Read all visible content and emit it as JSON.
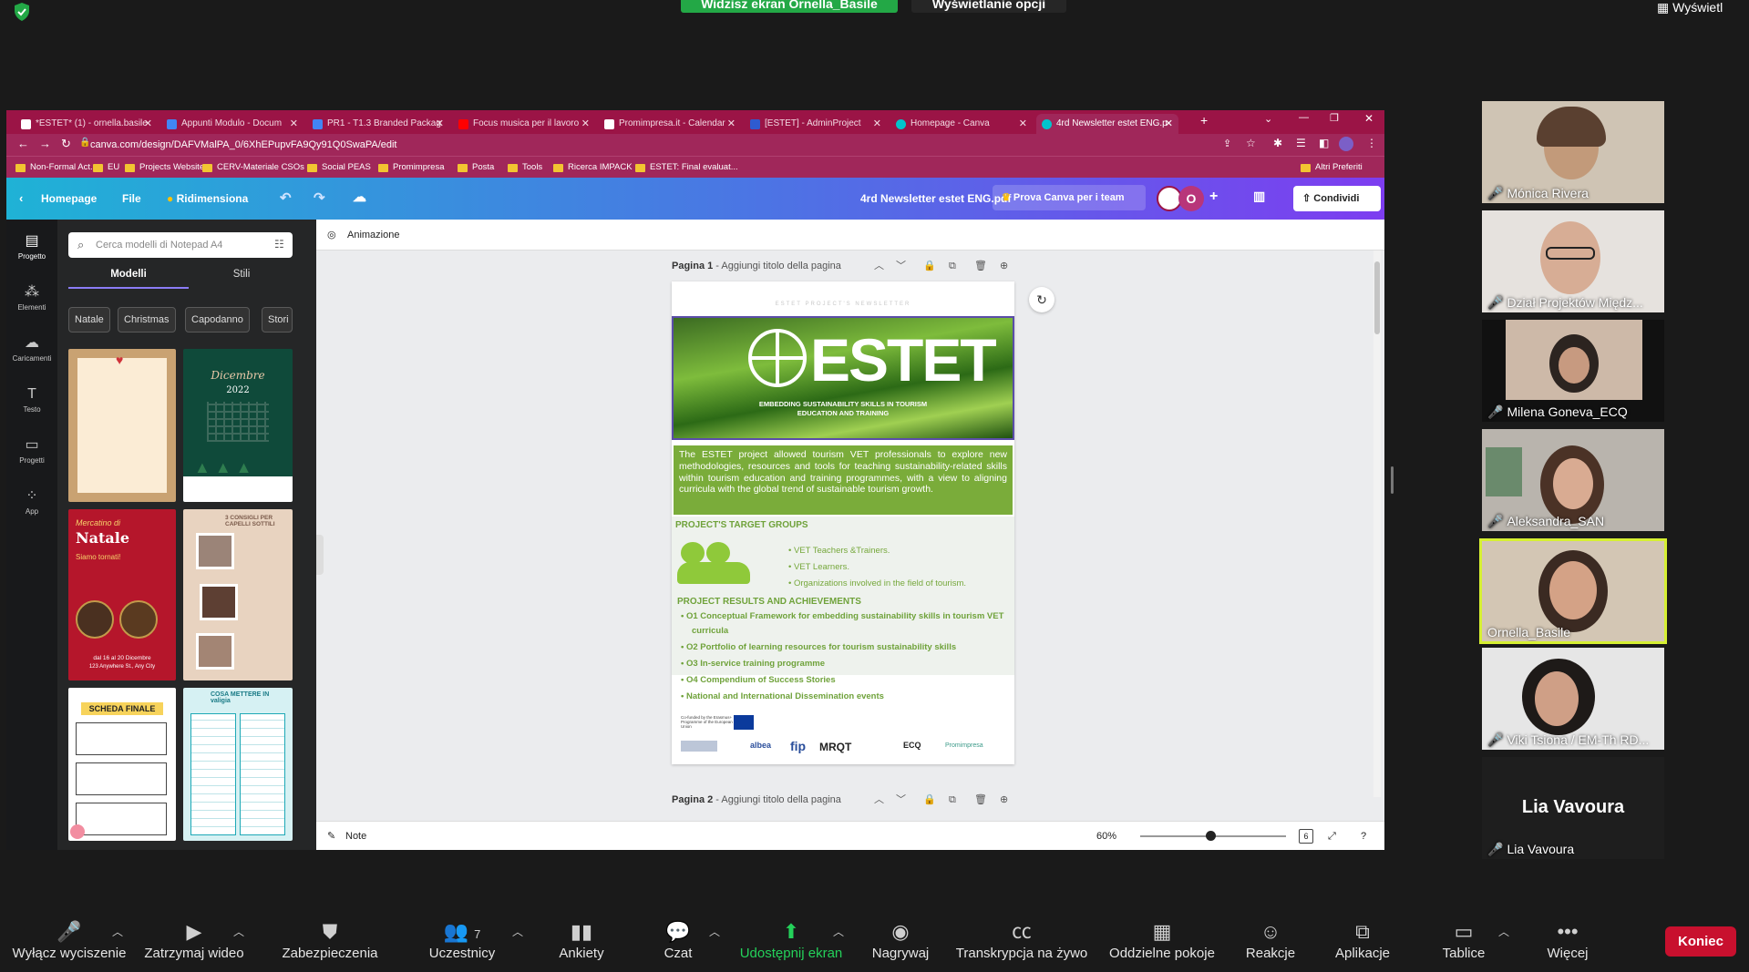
{
  "zoom": {
    "share_banner": "Widzisz ekran Ornella_Basile",
    "view_options": "Wyświetlanie opcji",
    "view_right": "Wyświetl",
    "end_button": "Koniec",
    "participant_count": "7",
    "toolbar": [
      {
        "label": "Wyłącz wyciszenie",
        "icon": "mic-muted-icon"
      },
      {
        "label": "Zatrzymaj wideo",
        "icon": "video-icon"
      },
      {
        "label": "Zabezpieczenia",
        "icon": "shield-icon"
      },
      {
        "label": "Uczestnicy",
        "icon": "people-icon"
      },
      {
        "label": "Ankiety",
        "icon": "bar-chart-icon"
      },
      {
        "label": "Czat",
        "icon": "chat-icon"
      },
      {
        "label": "Udostępnij ekran",
        "icon": "share-screen-icon"
      },
      {
        "label": "Nagrywaj",
        "icon": "record-icon"
      },
      {
        "label": "Transkrypcja na żywo",
        "icon": "cc-icon"
      },
      {
        "label": "Oddzielne pokoje",
        "icon": "rooms-icon"
      },
      {
        "label": "Reakcje",
        "icon": "emoji-icon"
      },
      {
        "label": "Aplikacje",
        "icon": "apps-icon"
      },
      {
        "label": "Tablice",
        "icon": "whiteboard-icon"
      },
      {
        "label": "Więcej",
        "icon": "more-icon"
      }
    ],
    "participants": [
      {
        "name": "Mónica Rivera"
      },
      {
        "name": "Dział Projektów Międz..."
      },
      {
        "name": "Milena Goneva_ECQ"
      },
      {
        "name": "Aleksandra_SAN"
      },
      {
        "name": "Ornella_Basile"
      },
      {
        "name": "Viki Tsiona / EM-Th RD..."
      },
      {
        "name": "Lia Vavoura"
      }
    ],
    "lia_big": "Lia Vavoura"
  },
  "browser": {
    "tabs": [
      "*ESTET* (1) - ornella.basile",
      "Appunti Modulo - Docum",
      "PR1 - T1.3 Branded Packag",
      "Focus musica per il lavoro",
      "Promimpresa.it - Calendar",
      "[ESTET] - AdminProject",
      "Homepage - Canva",
      "4rd Newsletter estet ENG.p"
    ],
    "url": "canva.com/design/DAFVMalPA_0/6XhEPupvFA9Qy91Q0SwaPA/edit",
    "bookmarks": [
      "Non-Formal Act.",
      "EU",
      "Projects Website",
      "CERV-Materiale CSOs",
      "Social PEAS",
      "Promimpresa",
      "Posta",
      "Tools",
      "Ricerca IMPACK",
      "ESTET: Final evaluat..."
    ],
    "bookmarks_right": "Altri Preferiti"
  },
  "canva": {
    "home": "Homepage",
    "file": "File",
    "resize": "Ridimensiona",
    "doc_title": "4rd Newsletter estet ENG.pdf",
    "try_team": "Prova Canva per i team",
    "share": "Condividi",
    "nav": [
      "Progetto",
      "Elementi",
      "Caricamenti",
      "Testo",
      "Progetti",
      "App"
    ],
    "search_placeholder": "Cerca modelli di Notepad A4",
    "tab_models": "Modelli",
    "tab_styles": "Stili",
    "chips": [
      "Natale",
      "Christmas",
      "Capodanno",
      "Stori"
    ],
    "animation": "Animazione",
    "page1": "Pagina 1",
    "page2": "Pagina 2",
    "page_title_hint": "Aggiungi titolo della pagina",
    "note": "Note",
    "zoom": "60%",
    "page_count": "6",
    "thumbs": {
      "dicembre": "Dicembre",
      "year": "2022",
      "mercatino": "Mercatino di",
      "natale": "Natale",
      "siamo": "Siamo tornati!",
      "dates": "dal 16 al 20 Dicembre",
      "address": "123 Anywhere St., Any City",
      "consigli": "3 CONSIGLI PER CAPELLI SOTTILI",
      "scheda": "SCHEDA FINALE",
      "valigia": "COSA METTERE IN valigia"
    }
  },
  "newsletter": {
    "kicker": "ESTET PROJECT'S NEWSLETTER",
    "brand": "ESTET",
    "tagline_1": "EMBEDDING SUSTAINABILITY SKILLS IN TOURISM",
    "tagline_2": "EDUCATION AND TRAINING",
    "intro": "The ESTET project allowed tourism VET professionals to explore new methodologies, resources and tools for teaching sustainability-related skills within tourism education and training programmes, with a view to aligning curricula with the global trend of sustainable tourism growth.",
    "target_heading": "PROJECT'S TARGET GROUPS",
    "targets": [
      "VET Teachers &Trainers.",
      "VET Learners.",
      "Organizations involved in the field of tourism."
    ],
    "results_heading": "PROJECT RESULTS AND ACHIEVEMENTS",
    "results": [
      "O1 Conceptual Framework for embedding sustainability skills in tourism VET",
      "curricula",
      "O2 Portfolio of learning resources for tourism sustainability skills",
      "O3 In-service training programme",
      "O4 Compendium of Success Stories",
      "National and International Dissemination events"
    ],
    "erasmus": "Co-funded by the Erasmus+ Programme of the European Union",
    "partners": [
      "albea",
      "fip",
      "MRQT",
      "ECQ",
      "Promimpresa"
    ]
  }
}
